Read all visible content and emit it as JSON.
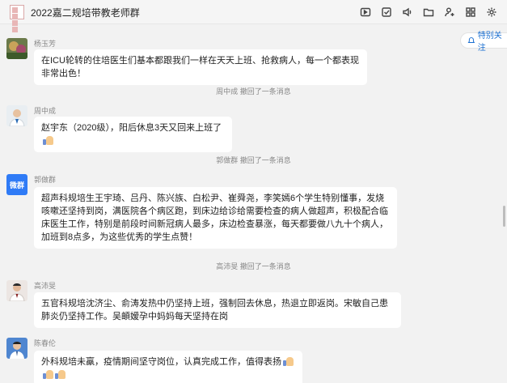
{
  "header": {
    "title": "2022嘉二规培带教老师群",
    "tools": [
      "chat-history-icon",
      "task-check-icon",
      "announce-icon",
      "folder-icon",
      "add-member-icon",
      "apps-icon",
      "settings-icon"
    ]
  },
  "follow_button": {
    "label": "特别关注"
  },
  "messages": [
    {
      "sender": "杨玉芳",
      "text": "在ICU轮转的住培医生们基本都跟我们一样在天天上班、抢救病人，每一个都表现非常出色！"
    },
    {
      "sender": "周中成",
      "text": "赵宇东（2020级），阳后休息3天又回来上班了"
    },
    {
      "sender": "郭做群",
      "avatar_text": "微群",
      "text": "超声科规培生王宇琦、吕丹、陈兴族、白松尹、崔舜尧，李笑嫣6个学生特别懂事，发烧咳嗽还坚持到岗，满医院各个病区跑，到床边给诊给需要检查的病人做超声，积极配合临床医生工作，特别是前段时间新冠病人最多，床边检查暴涨，每天都要做八九十个病人，加班到8点多，为这些优秀的学生点赞！"
    },
    {
      "sender": "高沛旻",
      "text": "五官科规培沈济尘、俞涛发热中仍坚持上班，强制回去休息，热退立即返岗。宋敏自己患肺炎仍坚持工作。吴頔嫒孕中妈妈每天坚持在岗"
    },
    {
      "sender": "陈春伦",
      "text": "外科规培未羸，疫情期间坚守岗位，认真完成工作，值得表扬"
    }
  ],
  "notices": [
    "周中成 撤回了一条消息",
    "郭做群 撤回了一条消息",
    "高沛旻 撤回了一条消息"
  ],
  "colors": {
    "background": "#f2f2f2",
    "bubble": "#ffffff",
    "accent": "#1a6fd1",
    "wechat_work_blue": "#2f7bf6"
  }
}
